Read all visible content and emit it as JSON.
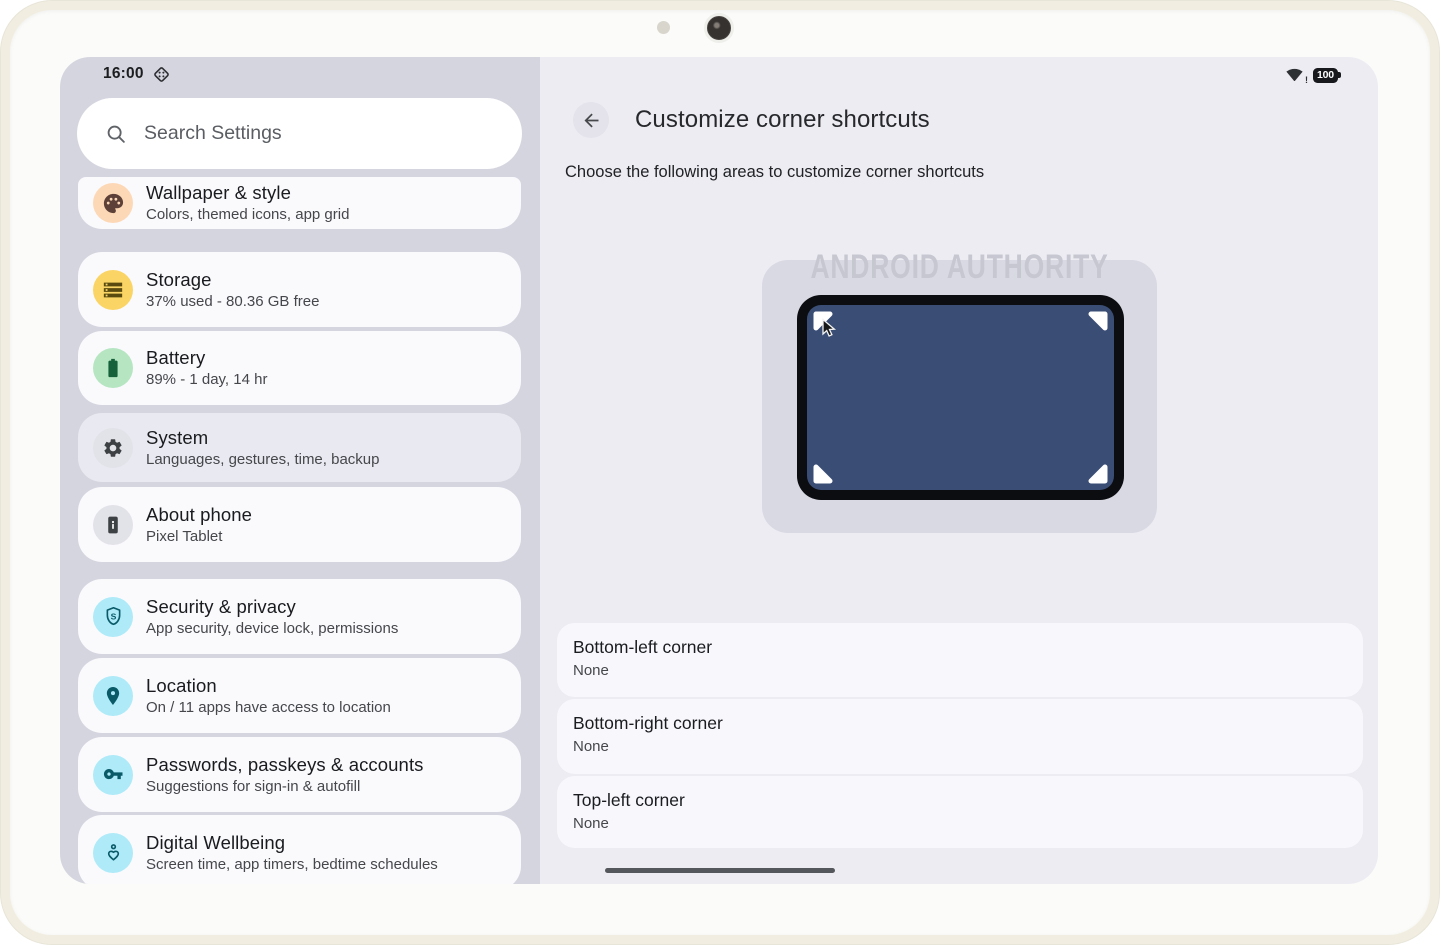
{
  "device": {
    "time": "16:00",
    "battery_level": "100"
  },
  "sidebar": {
    "search_placeholder": "Search Settings",
    "items": [
      {
        "id": "wallpaper",
        "label": "Wallpaper & style",
        "sublabel": "Colors, themed icons, app grid",
        "icon": "palette-icon",
        "icon_bg": "#fdd8b6",
        "icon_color": "#5d4037",
        "selected": false
      },
      {
        "id": "storage",
        "label": "Storage",
        "sublabel": "37% used - 80.36 GB free",
        "icon": "storage-icon",
        "icon_bg": "#fad565",
        "icon_color": "#5a4a10",
        "selected": false
      },
      {
        "id": "battery",
        "label": "Battery",
        "sublabel": "89% - 1 day, 14 hr",
        "icon": "battery-icon",
        "icon_bg": "#b6e5c1",
        "icon_color": "#17613a",
        "selected": false
      },
      {
        "id": "system",
        "label": "System",
        "sublabel": "Languages, gestures, time, backup",
        "icon": "gear-icon",
        "icon_bg": "#e2e2e9",
        "icon_color": "#3e4144",
        "selected": true
      },
      {
        "id": "about-phone",
        "label": "About phone",
        "sublabel": "Pixel Tablet",
        "icon": "phone-icon",
        "icon_bg": "#e2e2e9",
        "icon_color": "#3e4144",
        "selected": false
      },
      {
        "id": "security",
        "label": "Security & privacy",
        "sublabel": "App security, device lock, permissions",
        "icon": "shield-icon",
        "icon_bg": "#aeeaf8",
        "icon_color": "#0a5a68",
        "selected": false
      },
      {
        "id": "location",
        "label": "Location",
        "sublabel": "On / 11 apps have access to location",
        "icon": "pin-icon",
        "icon_bg": "#aeeaf8",
        "icon_color": "#0a5a68",
        "selected": false
      },
      {
        "id": "passwords",
        "label": "Passwords, passkeys & accounts",
        "sublabel": "Suggestions for sign-in & autofill",
        "icon": "key-icon",
        "icon_bg": "#aeeaf8",
        "icon_color": "#0a5a68",
        "selected": false
      },
      {
        "id": "wellbeing",
        "label": "Digital Wellbeing",
        "sublabel": "Screen time, app timers, bedtime schedules",
        "icon": "wellbeing-icon",
        "icon_bg": "#aeeaf8",
        "icon_color": "#0a5a68",
        "selected": false
      }
    ]
  },
  "content": {
    "title": "Customize corner shortcuts",
    "subtitle": "Choose the following areas to customize corner shortcuts",
    "watermark": "ANDROID AUTHORITY",
    "corner_options": [
      {
        "label": "Bottom-left corner",
        "value": "None"
      },
      {
        "label": "Bottom-right corner",
        "value": "None"
      },
      {
        "label": "Top-left corner",
        "value": "None"
      }
    ]
  },
  "colors": {
    "preview_screen": "#3a4d74",
    "preview_border": "#0c0d10",
    "sidebar_bg": "#d5d5df",
    "content_bg": "#edecf3",
    "selected_card": "#e9e9f1"
  }
}
